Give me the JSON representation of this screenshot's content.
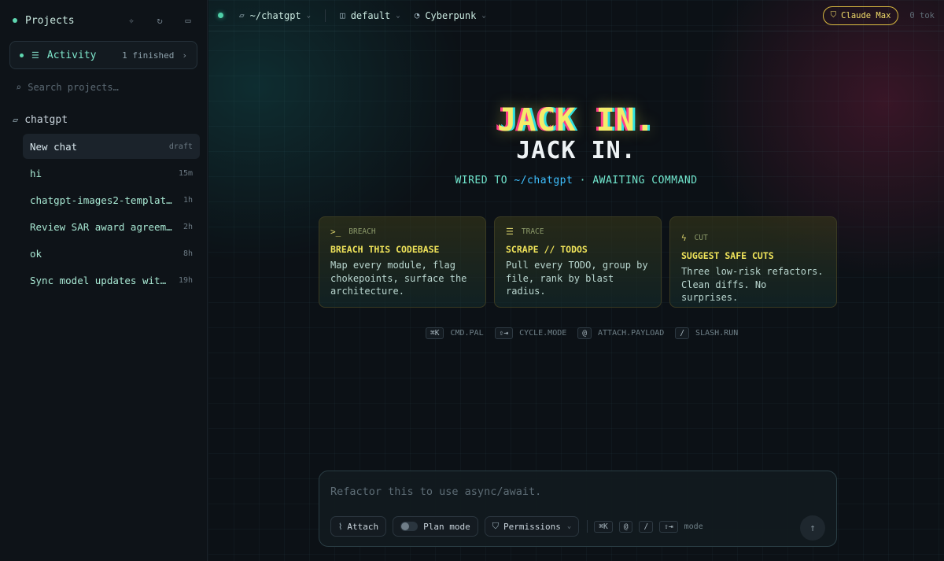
{
  "sidebar": {
    "title": "Projects",
    "activity": {
      "label": "Activity",
      "count": "1 finished"
    },
    "search_placeholder": "Search projects…",
    "project": {
      "name": "chatgpt"
    },
    "chats": [
      {
        "title": "New chat",
        "age": "draft",
        "active": true
      },
      {
        "title": "hi",
        "age": "15m"
      },
      {
        "title": "chatgpt-images2-template-…",
        "age": "1h"
      },
      {
        "title": "Review SAR award agreemen…",
        "age": "2h"
      },
      {
        "title": "ok",
        "age": "8h"
      },
      {
        "title": "Sync model updates with …",
        "age": "19h"
      }
    ]
  },
  "topbar": {
    "path": "~/chatgpt",
    "profile": "default",
    "theme": "Cyberpunk",
    "plan_badge": "Claude Max",
    "tokens": "0 tok"
  },
  "hero": {
    "glitch_title": "JACK IN.",
    "title": "JACK IN.",
    "sub_prefix": "WIRED TO",
    "sub_path": "~/chatgpt",
    "sub_suffix": "· AWAITING COMMAND"
  },
  "cards": [
    {
      "tag": "BREACH",
      "title": "BREACH THIS CODEBASE",
      "desc": "Map every module, flag chokepoints, surface the architecture."
    },
    {
      "tag": "TRACE",
      "title": "SCRAPE // TODOS",
      "desc": "Pull every TODO, group by file, rank by blast radius."
    },
    {
      "tag": "CUT",
      "title": "SUGGEST SAFE CUTS",
      "desc": "Three low-risk refactors. Clean diffs. No surprises."
    }
  ],
  "shortcuts": [
    {
      "key": "⌘K",
      "label": "CMD.PAL"
    },
    {
      "key": "⇧⇥",
      "label": "CYCLE.MODE"
    },
    {
      "key": "@",
      "label": "ATTACH.PAYLOAD"
    },
    {
      "key": "/",
      "label": "SLASH.RUN"
    }
  ],
  "composer": {
    "placeholder": "Refactor this to use async/await.",
    "attach": "Attach",
    "plan_mode": "Plan mode",
    "permissions": "Permissions",
    "mini_keys": [
      "⌘K",
      "@",
      "/",
      "⇧⇥"
    ],
    "mode_label": "mode"
  },
  "colors": {
    "accent": "#5fd7b0",
    "glitch_yellow": "#f4ec6a",
    "badge_gold": "#d9b940"
  }
}
